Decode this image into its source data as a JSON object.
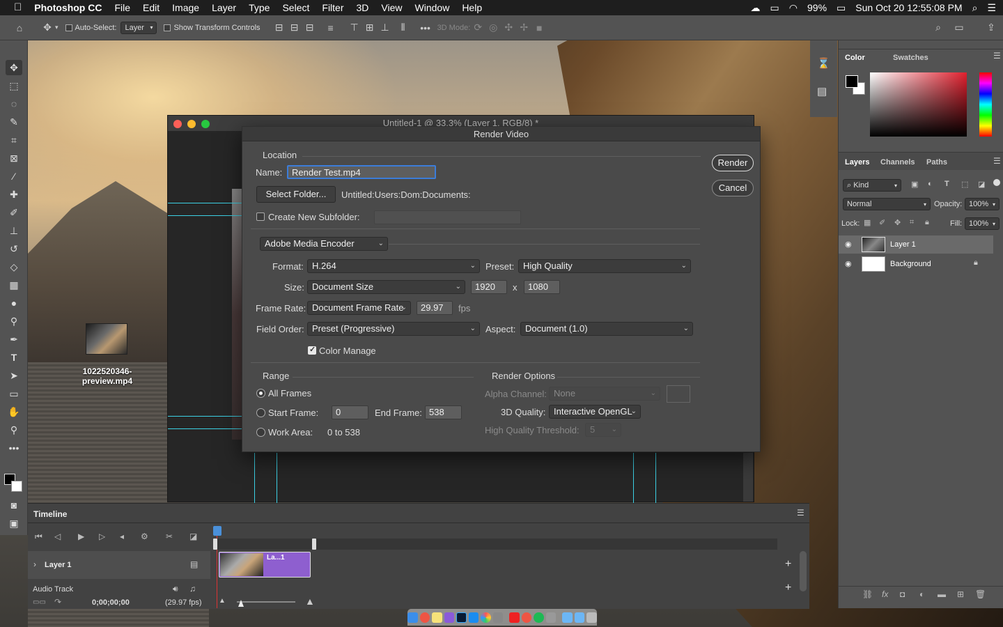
{
  "menubar": {
    "apple": "",
    "app": "Photoshop CC",
    "items": [
      "File",
      "Edit",
      "Image",
      "Layer",
      "Type",
      "Select",
      "Filter",
      "3D",
      "View",
      "Window",
      "Help"
    ],
    "battery": "99%",
    "datetime": "Sun Oct 20  12:55:08 PM"
  },
  "options": {
    "auto_select": "Auto-Select:",
    "auto_select_value": "Layer",
    "show_transform": "Show Transform Controls",
    "mode_3d": "3D Mode:"
  },
  "desktop": {
    "file_label": "1022520346-\npreview.mp4"
  },
  "document": {
    "title": "Untitled-1 @ 33.3% (Layer 1, RGB/8) *"
  },
  "dialog": {
    "title": "Render Video",
    "location_header": "Location",
    "name_label": "Name:",
    "name_value": "Render Test.mp4",
    "select_folder": "Select Folder...",
    "folder_path": "Untitled:Users:Dom:Documents:",
    "subfolder_label": "Create New Subfolder:",
    "encoder": "Adobe Media Encoder",
    "format_label": "Format:",
    "format_value": "H.264",
    "preset_label": "Preset:",
    "preset_value": "High Quality",
    "size_label": "Size:",
    "size_value": "Document Size",
    "width": "1920",
    "x_sep": "x",
    "height": "1080",
    "framerate_label": "Frame Rate:",
    "framerate_value": "Document Frame Rate",
    "fps_value": "29.97",
    "fps_unit": "fps",
    "fieldorder_label": "Field Order:",
    "fieldorder_value": "Preset (Progressive)",
    "aspect_label": "Aspect:",
    "aspect_value": "Document (1.0)",
    "color_manage": "Color Manage",
    "range_header": "Range",
    "all_frames": "All Frames",
    "start_frame_label": "Start Frame:",
    "start_frame": "0",
    "end_frame_label": "End Frame:",
    "end_frame": "538",
    "work_area_label": "Work Area:",
    "work_area": "0 to 538",
    "render_options_header": "Render Options",
    "alpha_label": "Alpha Channel:",
    "alpha_value": "None",
    "quality3d_label": "3D Quality:",
    "quality3d_value": "Interactive OpenGL",
    "hq_threshold_label": "High Quality Threshold:",
    "hq_threshold": "5",
    "render_btn": "Render",
    "cancel_btn": "Cancel"
  },
  "panels": {
    "color_tab": "Color",
    "swatches_tab": "Swatches",
    "layers_tab": "Layers",
    "channels_tab": "Channels",
    "paths_tab": "Paths",
    "kind": "Kind",
    "blend": "Normal",
    "opacity_label": "Opacity:",
    "opacity": "100%",
    "lock_label": "Lock:",
    "fill_label": "Fill:",
    "fill": "100%",
    "layers": [
      {
        "name": "Layer 1"
      },
      {
        "name": "Background"
      }
    ]
  },
  "timeline": {
    "title": "Timeline",
    "track": "Layer 1",
    "clip": "La...1",
    "audio": "Audio Track",
    "timecode": "0;00;00;00",
    "fps": "(29.97 fps)"
  },
  "colors": {
    "accent": "#4a90d9",
    "clip": "#8e5fcf"
  }
}
